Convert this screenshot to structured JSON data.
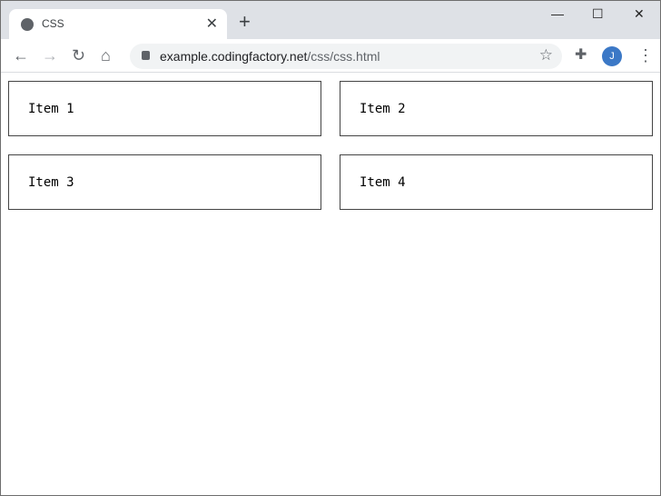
{
  "browser": {
    "tab_title": "CSS",
    "url_host": "example.codingfactory.net",
    "url_path": "/css/css.html",
    "avatar_letter": "J"
  },
  "items": [
    "Item 1",
    "Item 2",
    "Item 3",
    "Item 4"
  ]
}
